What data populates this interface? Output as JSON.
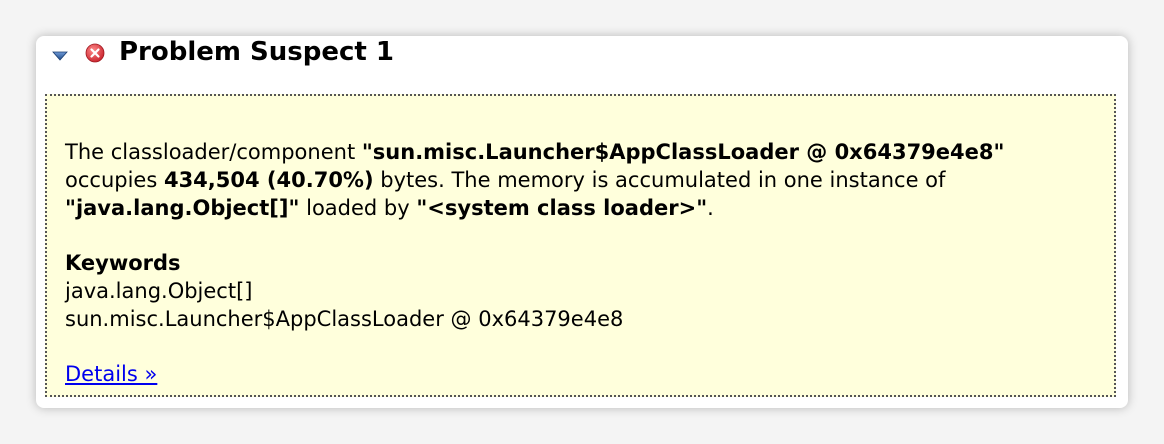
{
  "header": {
    "toggle_icon": "expand-triangle-icon",
    "status_icon": "error-icon",
    "title": "Problem Suspect 1"
  },
  "description": {
    "part1": "The classloader/component ",
    "component": "\"sun.misc.Launcher$AppClassLoader @ 0x64379e4e8\"",
    "part2": "occupies ",
    "size": "434,504 (40.70%)",
    "part3": " bytes. The memory is accumulated in one instance of",
    "instance_class": "\"java.lang.Object[]\"",
    "part4": " loaded by ",
    "loader": "\"<system class loader>\"",
    "part5": "."
  },
  "keywords": {
    "heading": "Keywords",
    "items": [
      "java.lang.Object[]",
      "sun.misc.Launcher$AppClassLoader @ 0x64379e4e8"
    ]
  },
  "details_link": "Details »",
  "colors": {
    "panel_bg": "#ffffdc",
    "link": "#0000ee",
    "error_red": "#e0303a",
    "toggle_blue": "#2a5a9c"
  }
}
